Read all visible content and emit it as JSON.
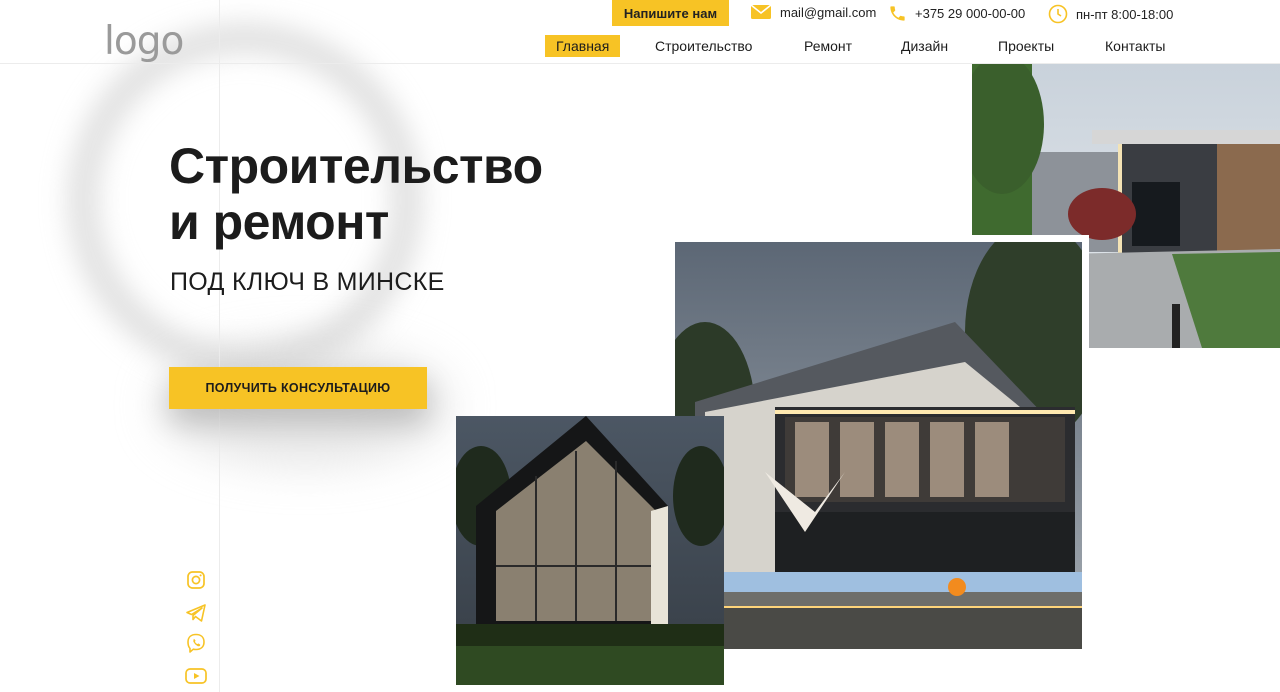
{
  "brand": {
    "logo_text": "logo"
  },
  "topbar": {
    "write_button": "Напишите нам",
    "email": "mail@gmail.com",
    "phone": "+375 29 000-00-00",
    "hours": "пн-пт 8:00-18:00"
  },
  "nav": {
    "items": [
      {
        "label": "Главная",
        "active": true
      },
      {
        "label": "Строительство"
      },
      {
        "label": "Ремонт"
      },
      {
        "label": "Дизайн"
      },
      {
        "label": "Проекты"
      },
      {
        "label": "Контакты"
      }
    ]
  },
  "hero": {
    "title_line1": "Строительство",
    "title_line2": "и ремонт",
    "subtitle": "ПОД КЛЮЧ В МИНСКЕ",
    "cta": "ПОЛУЧИТЬ КОНСУЛЬТАЦИЮ"
  },
  "social": [
    "instagram-icon",
    "telegram-icon",
    "viber-icon",
    "youtube-icon"
  ],
  "colors": {
    "accent": "#f7c325",
    "text": "#1c1c1c",
    "logo": "#9a9a9a"
  }
}
